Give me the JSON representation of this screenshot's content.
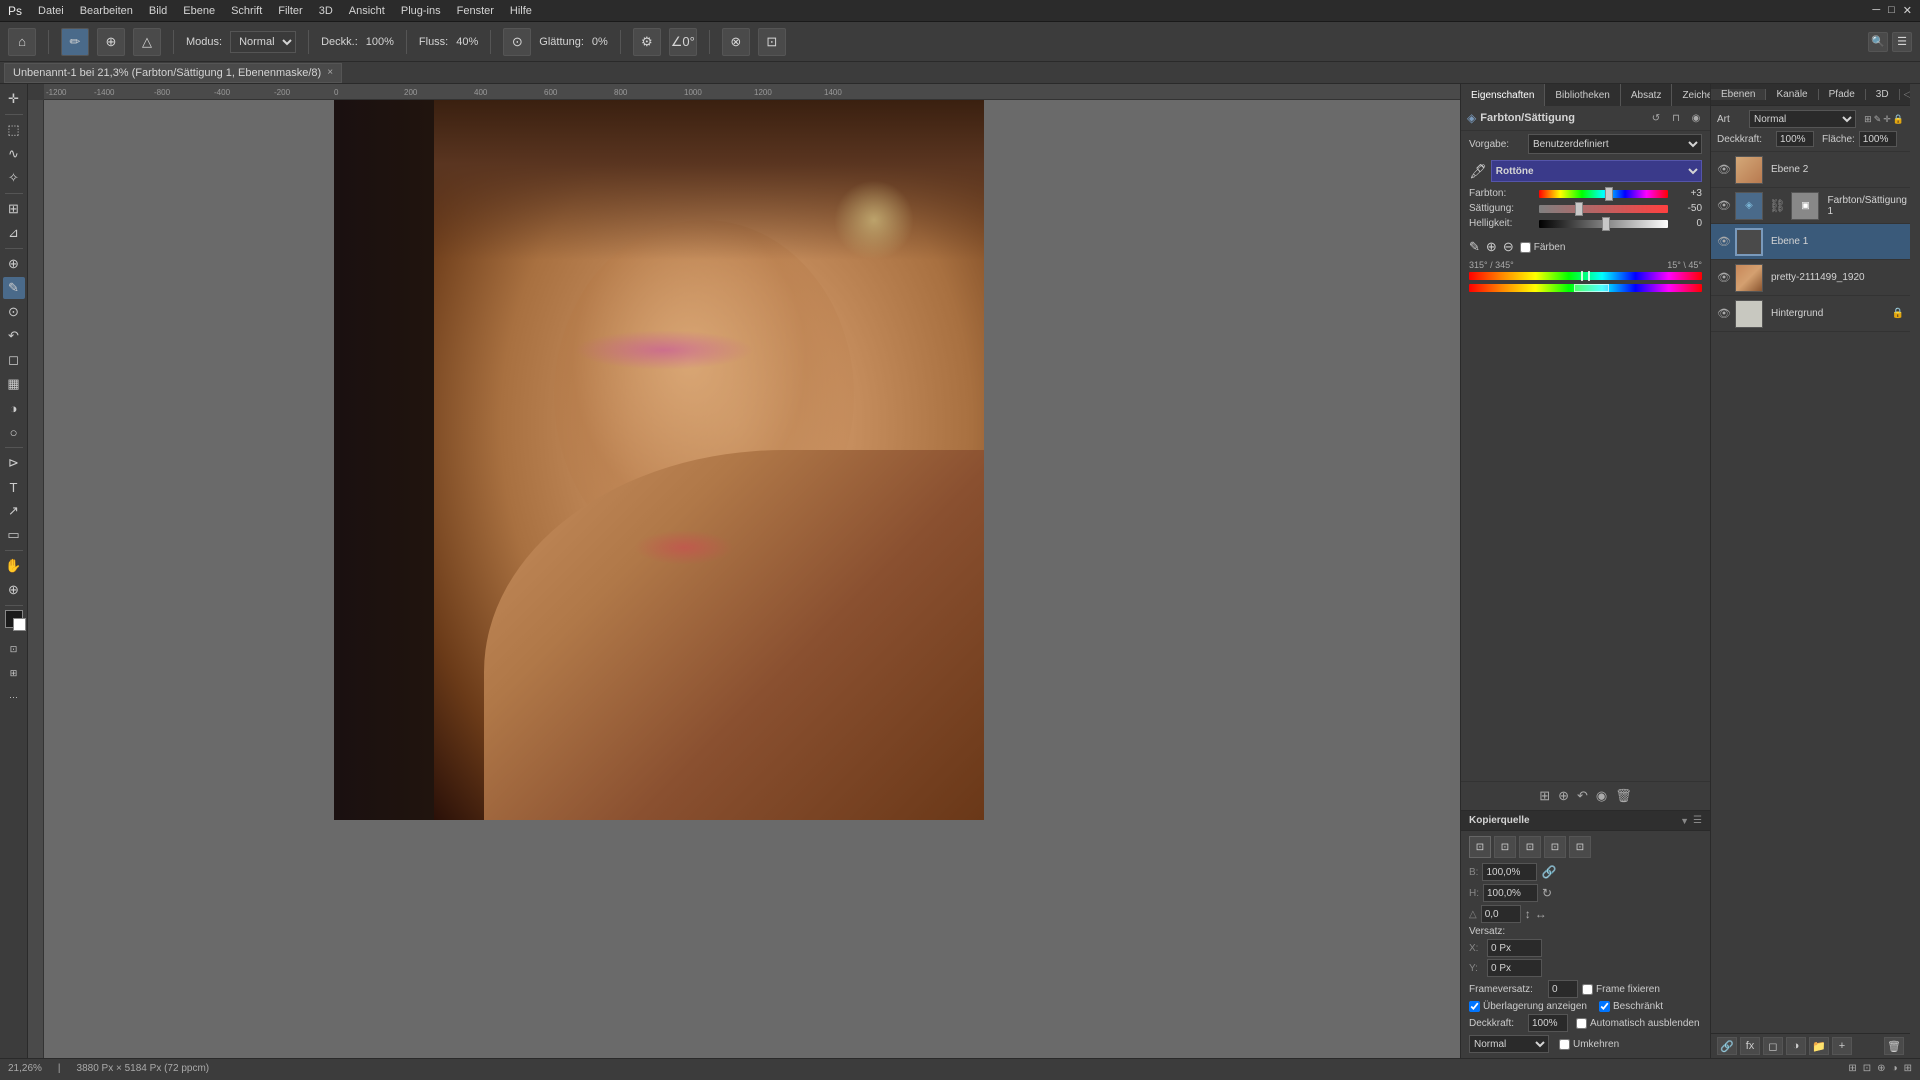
{
  "menu": {
    "items": [
      "Datei",
      "Bearbeiten",
      "Bild",
      "Ebene",
      "Schrift",
      "Filter",
      "3D",
      "Ansicht",
      "Plug-ins",
      "Fenster",
      "Hilfe"
    ]
  },
  "toolbar": {
    "mode_label": "Modus:",
    "mode_value": "Normal",
    "opacity_label": "Deckk.:",
    "opacity_value": "100%",
    "flow_label": "Fluss:",
    "flow_value": "40%",
    "smoothing_label": "Glättung:",
    "smoothing_value": "0%"
  },
  "tab": {
    "title": "Unbenannt-1 bei 21,3% (Farbton/Sättigung 1, Ebenenmaske/8)",
    "close": "×"
  },
  "properties": {
    "tabs": [
      "Eigenschaften",
      "Bibliotheken",
      "Absatz",
      "Zeichen"
    ],
    "active_tab": "Eigenschaften",
    "title": "Farbton/Sättigung",
    "vorgabe_label": "Vorgabe:",
    "vorgabe_value": "Benutzerdefiniert",
    "channel_label": "Rottöne",
    "farben_label": "Farbton:",
    "farben_value": "+3",
    "saettigung_label": "Sättigung:",
    "saettigung_value": "-50",
    "helligkeit_label": "Helligkeit:",
    "helligkeit_value": "0",
    "farben_checkbox": "Färben",
    "range_left": "315° / 345°",
    "range_right": "15° \\ 45°",
    "farbton_thumb_pos": "50%",
    "saettigung_thumb_pos": "30%",
    "helligkeit_thumb_pos": "50%"
  },
  "layers": {
    "panel_title": "Ebenen",
    "tabs": [
      "Ebenen",
      "Kanäle",
      "Pfade",
      "3D"
    ],
    "mode_label": "Art",
    "mode_value": "Normal",
    "opacity_label": "Deckkraft:",
    "opacity_value": "100%",
    "fill_label": "Fläche:",
    "fill_value": "100%",
    "lock_icons": [
      "🔒",
      "✦",
      "⊕",
      "🔒"
    ],
    "items": [
      {
        "name": "Ebene 2",
        "type": "normal",
        "visible": true,
        "locked": false
      },
      {
        "name": "Farbton/Sättigung 1",
        "type": "adjustment",
        "visible": true,
        "locked": false
      },
      {
        "name": "Ebene 1",
        "type": "normal",
        "visible": true,
        "locked": false,
        "active": true
      },
      {
        "name": "pretty-2111499_1920",
        "type": "photo",
        "visible": true,
        "locked": false
      },
      {
        "name": "Hintergrund",
        "type": "background",
        "visible": true,
        "locked": true
      }
    ],
    "bottom_btns": [
      "🔗",
      "fx",
      "◻",
      "◑",
      "📁",
      "🗑"
    ]
  },
  "kopierquelle": {
    "title": "Kopierquelle",
    "versatz_label": "Versatz:",
    "x_label": "X:",
    "x_value": "0 Px",
    "y_label": "Y:",
    "y_value": "0 Px",
    "b_label": "B:",
    "b_value": "100,0%",
    "h_label": "H:",
    "h_value": "100,0%",
    "winkel_label": "",
    "winkel_value": "0,0",
    "frameversatz_label": "Frameversatz:",
    "frameversatz_value": "0",
    "frame_checkbox": "Frame fixieren",
    "ueberlagerung_checkbox": "Überlagerung anzeigen",
    "beschraenkt_checkbox": "Beschränkt",
    "deckkraft_label": "Deckkraft:",
    "deckkraft_value": "100%",
    "autom_checkbox": "Automatisch ausblenden",
    "normal_label": "Normal",
    "umkehren_checkbox": "Umkehren"
  },
  "statusbar": {
    "zoom": "21,26%",
    "size": "3880 Px × 5184 Px (72 ppcm)"
  }
}
